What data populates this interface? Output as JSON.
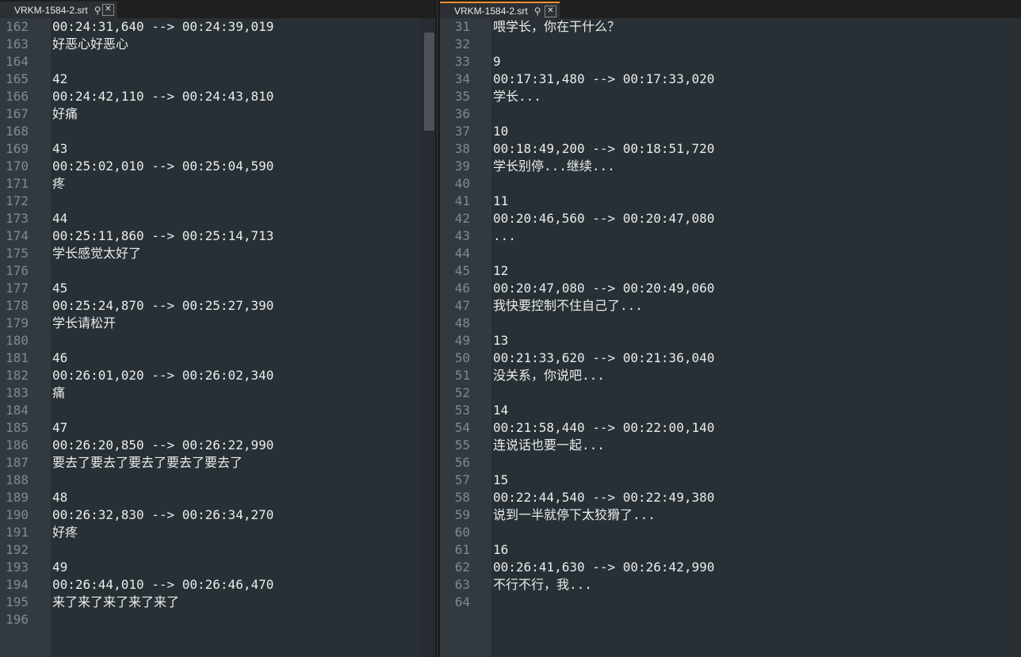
{
  "left_pane": {
    "tab": {
      "title": "VRKM-1584-2.srt",
      "pin": "⚲",
      "close": "✕"
    },
    "lines": [
      {
        "n": "162",
        "t": "00:24:31,640 --> 00:24:39,019"
      },
      {
        "n": "163",
        "t": "好恶心好恶心"
      },
      {
        "n": "164",
        "t": ""
      },
      {
        "n": "165",
        "t": "42"
      },
      {
        "n": "166",
        "t": "00:24:42,110 --> 00:24:43,810"
      },
      {
        "n": "167",
        "t": "好痛"
      },
      {
        "n": "168",
        "t": ""
      },
      {
        "n": "169",
        "t": "43"
      },
      {
        "n": "170",
        "t": "00:25:02,010 --> 00:25:04,590"
      },
      {
        "n": "171",
        "t": "疼"
      },
      {
        "n": "172",
        "t": ""
      },
      {
        "n": "173",
        "t": "44"
      },
      {
        "n": "174",
        "t": "00:25:11,860 --> 00:25:14,713"
      },
      {
        "n": "175",
        "t": "学长感觉太好了"
      },
      {
        "n": "176",
        "t": ""
      },
      {
        "n": "177",
        "t": "45"
      },
      {
        "n": "178",
        "t": "00:25:24,870 --> 00:25:27,390"
      },
      {
        "n": "179",
        "t": "学长请松开"
      },
      {
        "n": "180",
        "t": ""
      },
      {
        "n": "181",
        "t": "46"
      },
      {
        "n": "182",
        "t": "00:26:01,020 --> 00:26:02,340"
      },
      {
        "n": "183",
        "t": "痛"
      },
      {
        "n": "184",
        "t": ""
      },
      {
        "n": "185",
        "t": "47"
      },
      {
        "n": "186",
        "t": "00:26:20,850 --> 00:26:22,990"
      },
      {
        "n": "187",
        "t": "要去了要去了要去了要去了要去了"
      },
      {
        "n": "188",
        "t": ""
      },
      {
        "n": "189",
        "t": "48"
      },
      {
        "n": "190",
        "t": "00:26:32,830 --> 00:26:34,270"
      },
      {
        "n": "191",
        "t": "好疼"
      },
      {
        "n": "192",
        "t": ""
      },
      {
        "n": "193",
        "t": "49"
      },
      {
        "n": "194",
        "t": "00:26:44,010 --> 00:26:46,470"
      },
      {
        "n": "195",
        "t": "来了来了来了来了来了"
      },
      {
        "n": "196",
        "t": ""
      }
    ]
  },
  "right_pane": {
    "tab": {
      "title": "VRKM-1584-2.srt",
      "pin": "⚲",
      "close": "✕"
    },
    "lines": [
      {
        "n": "31",
        "t": "喂学长，你在干什么？"
      },
      {
        "n": "32",
        "t": ""
      },
      {
        "n": "33",
        "t": "9"
      },
      {
        "n": "34",
        "t": "00:17:31,480 --> 00:17:33,020"
      },
      {
        "n": "35",
        "t": "学长..."
      },
      {
        "n": "36",
        "t": ""
      },
      {
        "n": "37",
        "t": "10"
      },
      {
        "n": "38",
        "t": "00:18:49,200 --> 00:18:51,720"
      },
      {
        "n": "39",
        "t": "学长别停...继续..."
      },
      {
        "n": "40",
        "t": ""
      },
      {
        "n": "41",
        "t": "11"
      },
      {
        "n": "42",
        "t": "00:20:46,560 --> 00:20:47,080"
      },
      {
        "n": "43",
        "t": "..."
      },
      {
        "n": "44",
        "t": ""
      },
      {
        "n": "45",
        "t": "12"
      },
      {
        "n": "46",
        "t": "00:20:47,080 --> 00:20:49,060"
      },
      {
        "n": "47",
        "t": "我快要控制不住自己了..."
      },
      {
        "n": "48",
        "t": ""
      },
      {
        "n": "49",
        "t": "13"
      },
      {
        "n": "50",
        "t": "00:21:33,620 --> 00:21:36,040"
      },
      {
        "n": "51",
        "t": "没关系，你说吧..."
      },
      {
        "n": "52",
        "t": ""
      },
      {
        "n": "53",
        "t": "14"
      },
      {
        "n": "54",
        "t": "00:21:58,440 --> 00:22:00,140"
      },
      {
        "n": "55",
        "t": "连说话也要一起..."
      },
      {
        "n": "56",
        "t": ""
      },
      {
        "n": "57",
        "t": "15"
      },
      {
        "n": "58",
        "t": "00:22:44,540 --> 00:22:49,380"
      },
      {
        "n": "59",
        "t": "说到一半就停下太狡猾了..."
      },
      {
        "n": "60",
        "t": ""
      },
      {
        "n": "61",
        "t": "16"
      },
      {
        "n": "62",
        "t": "00:26:41,630 --> 00:26:42,990"
      },
      {
        "n": "63",
        "t": "不行不行，我..."
      },
      {
        "n": "64",
        "t": ""
      }
    ]
  },
  "colors": {
    "editor_bg": "#283035",
    "gutter_bg": "#323a40",
    "text": "#e9ecee",
    "line_number": "#7c8a94",
    "active_tab_accent": "#e8902f"
  }
}
